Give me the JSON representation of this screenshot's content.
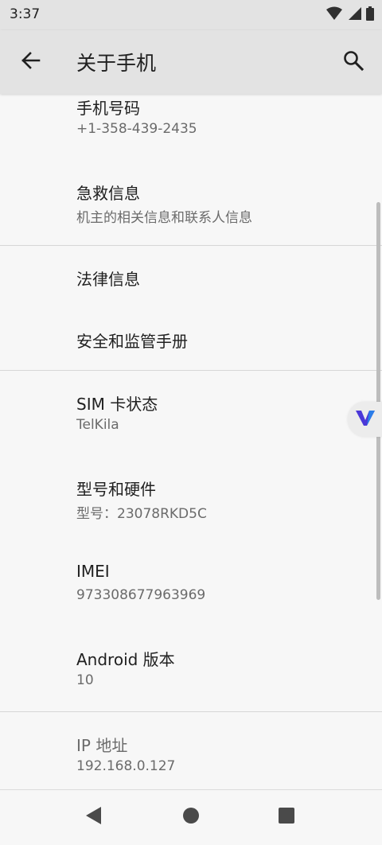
{
  "status_bar": {
    "time": "3:37"
  },
  "app_bar": {
    "title": "关于手机"
  },
  "list": [
    {
      "title": "手机号码",
      "summary": "+1-358-439-2435"
    },
    {
      "title": "急救信息",
      "summary": "机主的相关信息和联系人信息"
    },
    {
      "title": "法律信息"
    },
    {
      "title": "安全和监管手册"
    },
    {
      "title": "SIM 卡状态",
      "summary": "TelKila"
    },
    {
      "title": "型号和硬件",
      "summary": "型号：23078RKD5C"
    },
    {
      "title": "IMEI",
      "summary": "973308677963969"
    },
    {
      "title": "Android 版本",
      "summary": "10"
    },
    {
      "title": "IP 地址",
      "summary": "192.168.0.127"
    }
  ],
  "colors": {
    "app_bar_bg": "#e3e3e3",
    "background": "#f7f7f7",
    "floating_logo": "#4b38d8"
  },
  "icons": {
    "back": "arrow-left-icon",
    "search": "search-icon",
    "wifi": "wifi-icon",
    "signal": "signal-icon",
    "battery": "battery-icon",
    "floating": "v-logo-icon",
    "nav_back": "triangle-back-icon",
    "nav_home": "circle-home-icon",
    "nav_recents": "square-recents-icon"
  }
}
